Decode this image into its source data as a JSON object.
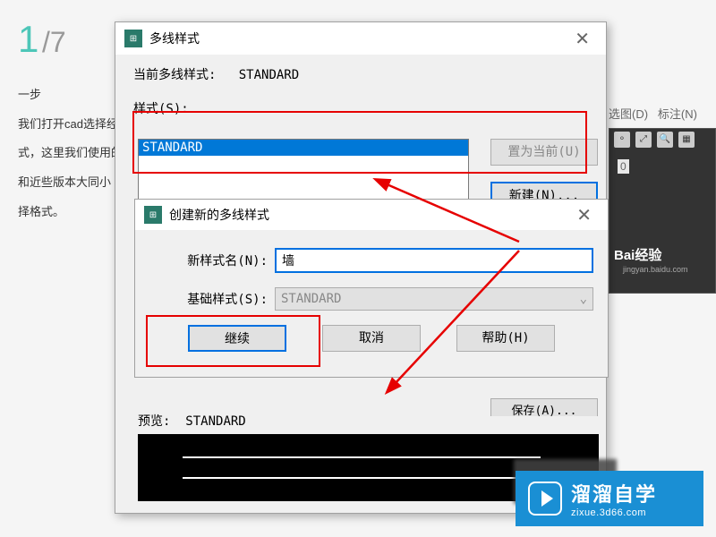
{
  "background": {
    "step_current": "1",
    "step_total": "/7",
    "heading_frag": "一步",
    "text1": "我们打开cad选择经典",
    "text2": "式，这里我们使用的",
    "text3": "和近些版本大同小",
    "text4": "择格式。",
    "menu_frag1": "选图(D)",
    "menu_frag2": "标注(N)",
    "coord": "0"
  },
  "baidu": {
    "logo": "Bai经验",
    "url": "jingyan.baidu.com"
  },
  "dialog_main": {
    "title": "多线样式",
    "current_label": "当前多线样式:",
    "current_value": "STANDARD",
    "styles_label": "样式(S):",
    "list_selected": "STANDARD",
    "btn_setcurrent": "置为当前(U)",
    "btn_new": "新建(N)...",
    "btn_partial": "保存(A)...",
    "preview_label": "预览:",
    "preview_value": "STANDARD"
  },
  "dialog_sub": {
    "title": "创建新的多线样式",
    "name_label": "新样式名(N):",
    "name_value": "墙",
    "base_label": "基础样式(S):",
    "base_value": "STANDARD",
    "btn_continue": "继续",
    "btn_cancel": "取消",
    "btn_help": "帮助(H)"
  },
  "watermark": {
    "main": "溜溜自学",
    "sub": "zixue.3d66.com"
  }
}
